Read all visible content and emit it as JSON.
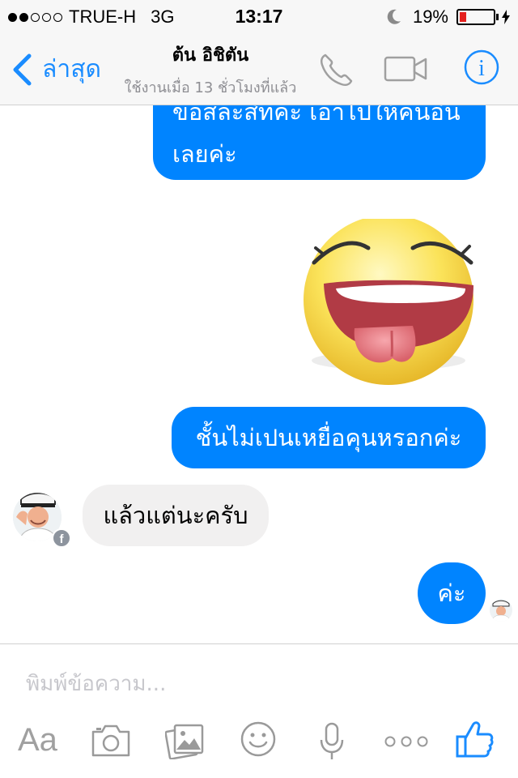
{
  "status_bar": {
    "carrier": "TRUE-H",
    "network": "3G",
    "time": "13:17",
    "battery": "19%",
    "battery_level": 0.19,
    "signal_strength": 2,
    "signal_max": 5
  },
  "nav": {
    "back_label": "ล่าสุด",
    "title": "ต้น อิชิตัน",
    "subtitle": "ใช้งานเมื่อ 13 ชั่วโมงที่แล้ว"
  },
  "messages": [
    {
      "id": "m1",
      "direction": "outgoing",
      "lines": [
        "ขอสละสิทค่ะ เอาไปให้คนอื่น",
        "เลยค่ะ"
      ]
    },
    {
      "id": "m2",
      "direction": "outgoing",
      "type": "sticker",
      "sticker": "laughing-tongue-face-sticker"
    },
    {
      "id": "m3",
      "direction": "outgoing",
      "text": "ชั้นไม่เปนเหยื่อคุนหรอกค่ะ"
    },
    {
      "id": "m4",
      "direction": "incoming",
      "text": "แล้วแต่นะครับ"
    },
    {
      "id": "m5",
      "direction": "outgoing",
      "text": "ค่ะ"
    }
  ],
  "composer": {
    "placeholder": "พิมพ์ข้อความ...",
    "aa_label": "Aa"
  },
  "icons": {
    "back": "chevron-left-icon",
    "phone": "phone-icon",
    "video": "video-camera-icon",
    "info": "info-icon",
    "camera": "camera-icon",
    "gallery": "photo-gallery-icon",
    "emoji": "smiley-icon",
    "mic": "microphone-icon",
    "more": "more-dots-icon",
    "like": "thumbs-up-icon",
    "moon": "moon-icon",
    "charging": "bolt-icon"
  },
  "colors": {
    "accent": "#0084ff",
    "ios_blue": "#1a8cff",
    "incoming_bubble": "#f1f0f0",
    "battery_low": "#e4201e"
  }
}
